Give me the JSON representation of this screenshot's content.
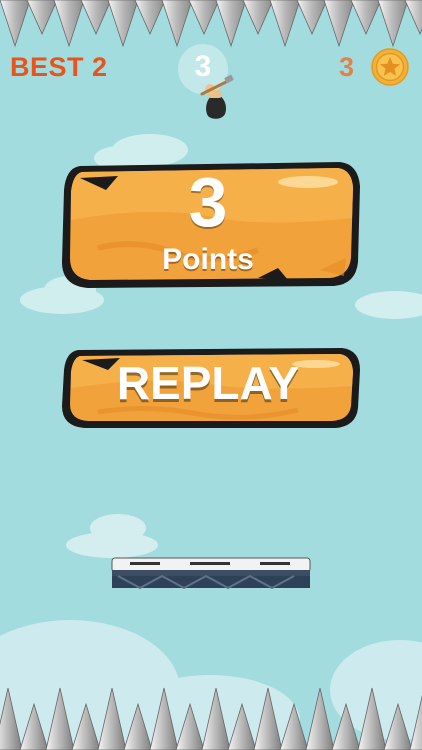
{
  "hud": {
    "best_label": "BEST 2",
    "live_score": "3",
    "coin_count": "3"
  },
  "result_panel": {
    "points_value": "3",
    "points_label": "Points"
  },
  "replay_button": {
    "label": "REPLAY"
  },
  "icons": {
    "coin": "star-coin-icon",
    "player": "climber-with-hammer-icon"
  },
  "colors": {
    "sky": "#a3dcdf",
    "best_text": "#e8541c",
    "coin_text": "#e0834a",
    "panel_orange": "#f2a23a",
    "coin_gold": "#f3b13a"
  }
}
